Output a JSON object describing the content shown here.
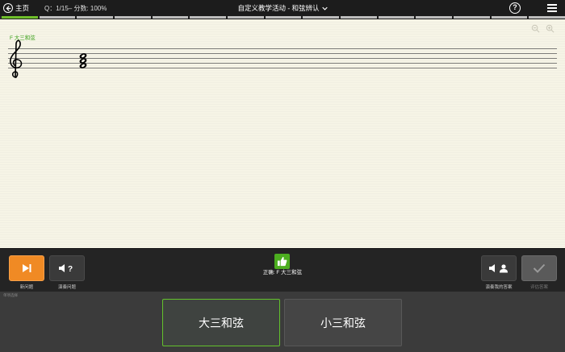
{
  "topbar": {
    "home_label": "主页",
    "quiz_status": "Q：1/15– 分数: 100%",
    "title": "自定义教学活动 - 和弦辨认",
    "title_chevron_icon": "chevron-down-icon",
    "help_label": "?"
  },
  "progress": {
    "total": 15,
    "completed": 1
  },
  "score": {
    "chord_label": "F 大三和弦",
    "clef": "treble-clef",
    "chord_notes": [
      "F4",
      "A4",
      "C5"
    ]
  },
  "controls": {
    "next_label": "新问题",
    "play_question_label": "演奏问题",
    "feedback_text": "正确: F 大三和弦",
    "play_answer_label": "演奏我的答案",
    "check_label": "评估答案"
  },
  "answers": {
    "section_label": "单项选择",
    "options": [
      "大三和弦",
      "小三和弦"
    ],
    "selected": 0
  },
  "colors": {
    "accent_green": "#6fbf2a",
    "next_orange": "#f08a24",
    "paper": "#f6f4e6"
  }
}
